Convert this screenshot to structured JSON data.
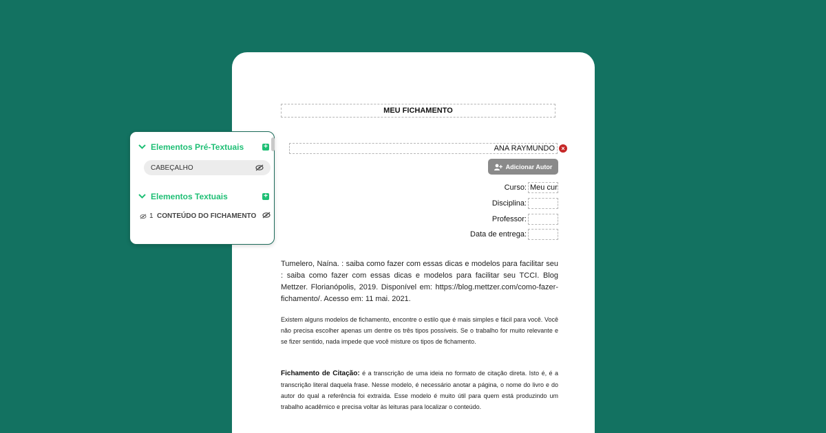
{
  "document": {
    "title": "MEU FICHAMENTO",
    "author": "ANA RAYMUNDO",
    "remove_author_icon": "×",
    "add_author_label": "Adicionar Autor",
    "fields": [
      {
        "label": "Curso:",
        "value": "Meu curso"
      },
      {
        "label": "Disciplina:",
        "value": ""
      },
      {
        "label": "Professor:",
        "value": ""
      },
      {
        "label": "Data de entrega:",
        "value": ""
      }
    ],
    "reference": "Tumelero, Naína. : saiba como fazer com essas dicas e modelos para facilitar seu : saiba como fazer com essas dicas e modelos para facilitar seu TCCI. Blog Mettzer. Florianópolis, 2019. Disponível em: https://blog.mettzer.com/como-fazer-fichamento/. Acesso em: 11 mai. 2021.",
    "intro": "Existem alguns modelos de fichamento, encontre o estilo que é mais simples e fácil para você. Você não precisa escolher apenas um dentre os três tipos possíveis. Se o trabalho for muito relevante e se fizer sentido, nada impede que você misture os tipos de fichamento.",
    "citation_title": "Fichamento de Citação:",
    "citation_text": " é a transcrição de uma ideia no formato de citação direta. Isto é, é a transcrição literal daquela frase. Nesse modelo, é necessário anotar a página, o nome do livro e do autor do qual a referência foi extraída. Esse modelo é muito útil para quem está produzindo um trabalho acadêmico e precisa voltar às leituras para localizar o conteúdo."
  },
  "panel": {
    "pre_textual": {
      "title": "Elementos Pré-Textuais",
      "items": [
        "CABEÇALHO"
      ]
    },
    "textual": {
      "title": "Elementos Textuais",
      "items": [
        {
          "number": "1",
          "label": "CONTEÚDO DO FICHAMENTO"
        }
      ]
    },
    "add_icon": "+",
    "chevron_icon": "chevron-down-icon"
  },
  "colors": {
    "background": "#137261",
    "accent": "#1fbf75",
    "button": "#8a8a8a",
    "remove": "#c62828"
  }
}
